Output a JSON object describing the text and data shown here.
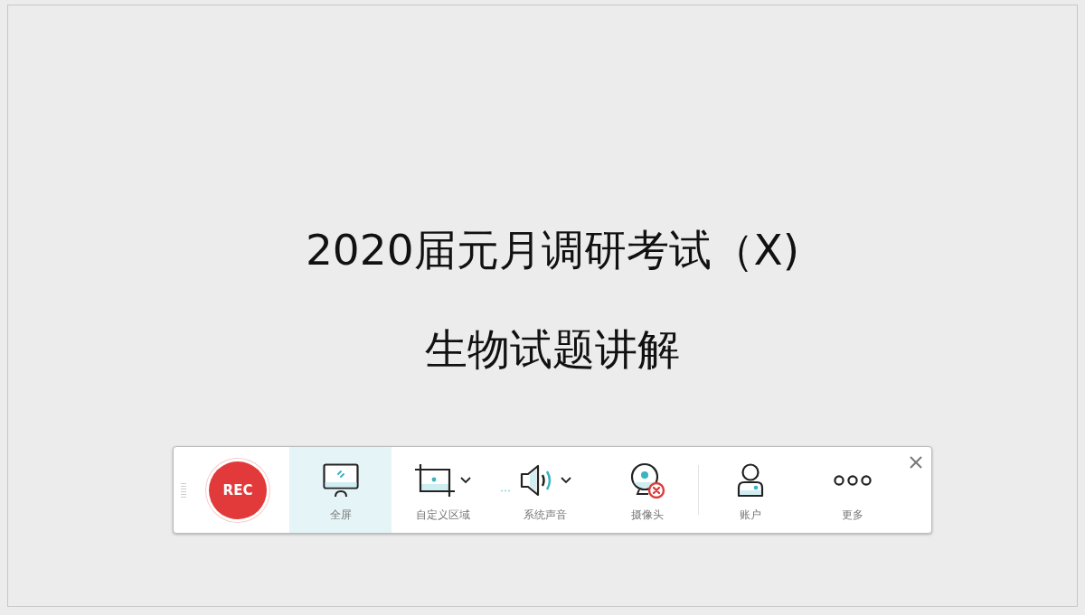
{
  "slide": {
    "title_lines": [
      "2020届元月调研考试（X)",
      "生物试题讲解"
    ]
  },
  "toolbar": {
    "record_button": "REC",
    "items": [
      {
        "kind": "screen",
        "label": "全屏",
        "selected": true,
        "dropdown": false,
        "off": false
      },
      {
        "kind": "region",
        "label": "自定义区域",
        "selected": false,
        "dropdown": true,
        "off": false
      },
      {
        "kind": "audio",
        "label": "系统声音",
        "selected": false,
        "dropdown": true,
        "off": false
      },
      {
        "kind": "camera",
        "label": "摄像头",
        "selected": false,
        "dropdown": false,
        "off": true
      },
      {
        "kind": "account",
        "label": "账户",
        "selected": false,
        "dropdown": false,
        "off": false
      },
      {
        "kind": "more",
        "label": "更多",
        "selected": false,
        "dropdown": false,
        "off": false
      }
    ]
  }
}
